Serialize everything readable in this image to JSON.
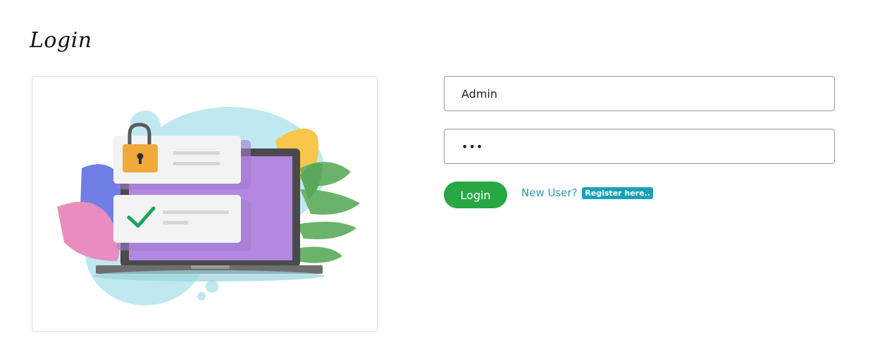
{
  "header": {
    "title": "Login"
  },
  "form": {
    "username_value": "Admin",
    "password_value": "•••",
    "login_label": "Login",
    "new_user_text": "New User?",
    "register_label": "Register here.."
  },
  "illustration": {
    "icons": [
      "padlock-icon",
      "checkmark-icon",
      "laptop-icon"
    ]
  },
  "colors": {
    "login_button": "#28a745",
    "register_badge": "#17a2b8",
    "link_text": "#2c9ab3"
  }
}
